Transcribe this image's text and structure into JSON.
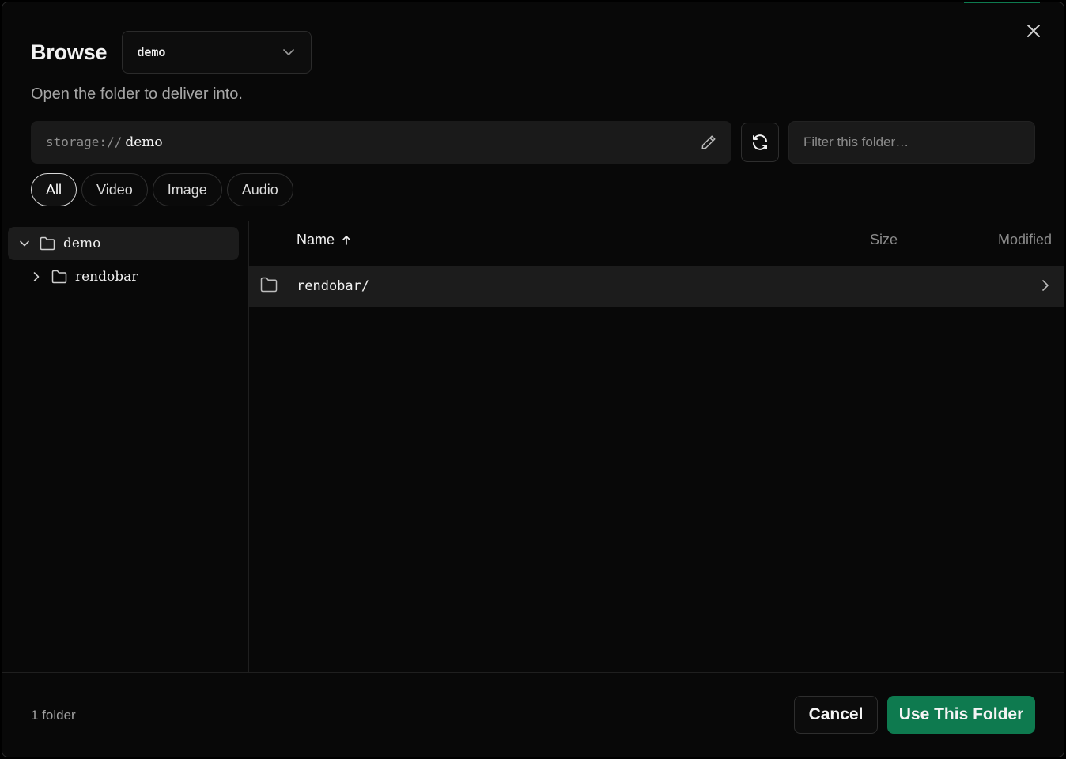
{
  "dialog": {
    "title": "Browse",
    "subtitle": "Open the folder to deliver into.",
    "accent_color": "#0e7a4f"
  },
  "bucket_select": {
    "value": "demo"
  },
  "path": {
    "scheme": "storage://",
    "segments": [
      "demo"
    ]
  },
  "filter": {
    "placeholder": "Filter this folder…",
    "value": ""
  },
  "chips": [
    {
      "label": "All",
      "active": true
    },
    {
      "label": "Video",
      "active": false
    },
    {
      "label": "Image",
      "active": false
    },
    {
      "label": "Audio",
      "active": false
    }
  ],
  "tree": [
    {
      "label": "demo",
      "expanded": true,
      "selected": true
    },
    {
      "label": "rendobar",
      "expanded": false,
      "selected": false
    }
  ],
  "list": {
    "columns": {
      "name": "Name",
      "size": "Size",
      "modified": "Modified"
    },
    "sort": {
      "column": "name",
      "direction": "ascending"
    },
    "rows": [
      {
        "name": "rendobar/",
        "type": "folder",
        "size": "",
        "modified": ""
      }
    ]
  },
  "footer": {
    "count_label": "1 folder",
    "cancel_label": "Cancel",
    "confirm_label": "Use This Folder"
  }
}
